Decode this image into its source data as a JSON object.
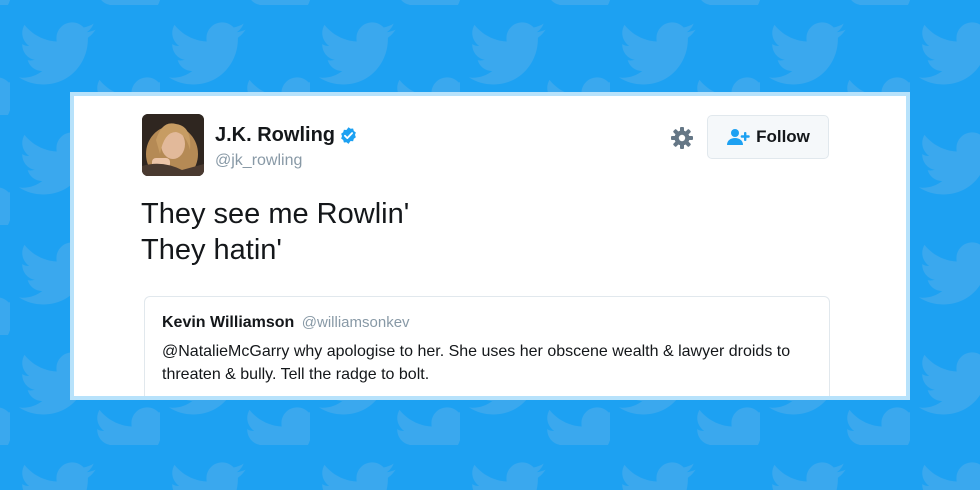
{
  "colors": {
    "background": "#1da1f2",
    "bird": "#3aa8ee",
    "verified": "#1da1f2",
    "text": "#14171a",
    "muted": "#8899a6"
  },
  "author": {
    "display_name": "J.K. Rowling",
    "handle": "@jk_rowling",
    "verified": true
  },
  "actions": {
    "settings_icon": "gear-icon",
    "follow_icon": "add-user-icon",
    "follow_label": "Follow"
  },
  "tweet": {
    "lines": [
      "They see me Rowlin'",
      "They hatin'"
    ]
  },
  "quoted_tweet": {
    "display_name": "Kevin Williamson",
    "handle": "@williamsonkev",
    "text": "@NatalieMcGarry why apologise to her. She uses her obscene wealth & lawyer droids to threaten & bully. Tell the radge to bolt."
  }
}
